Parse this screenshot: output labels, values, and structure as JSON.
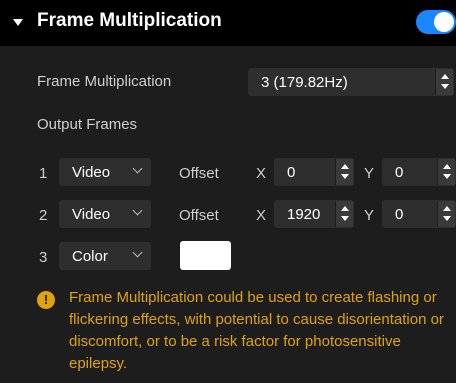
{
  "section": {
    "title": "Frame Multiplication",
    "enabled": true
  },
  "frame_multiplication": {
    "label": "Frame Multiplication",
    "value": "3 (179.82Hz)"
  },
  "output_frames": {
    "label": "Output Frames",
    "rows": [
      {
        "index": "1",
        "source": "Video",
        "offset_label": "Offset",
        "x_label": "X",
        "x_value": "0",
        "y_label": "Y",
        "y_value": "0"
      },
      {
        "index": "2",
        "source": "Video",
        "offset_label": "Offset",
        "x_label": "X",
        "x_value": "1920",
        "y_label": "Y",
        "y_value": "0"
      },
      {
        "index": "3",
        "source": "Color",
        "swatch_color": "#ffffff"
      }
    ]
  },
  "warning": {
    "text": "Frame Multiplication could be used to create flashing or flickering effects, with potential to cause disorientation or discomfort, or to be a risk factor for photosensitive epilepsy.",
    "icon": "!"
  },
  "colors": {
    "accent": "#1a86ff",
    "warning": "#e0a310"
  }
}
